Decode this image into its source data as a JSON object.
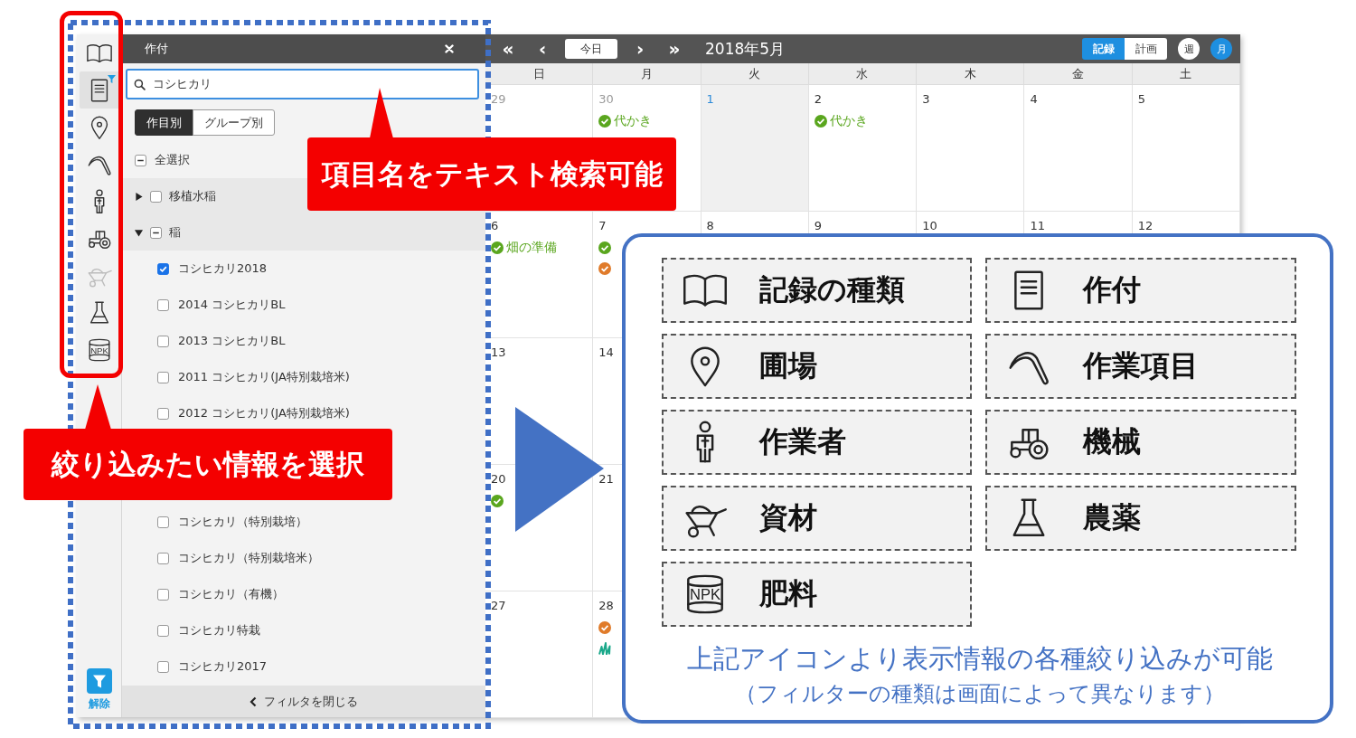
{
  "sidebar": {
    "items": [
      {
        "kind": "records",
        "selected": false,
        "disabled": false,
        "filtered": false
      },
      {
        "kind": "crops",
        "selected": true,
        "disabled": false,
        "filtered": true
      },
      {
        "kind": "fields",
        "selected": false,
        "disabled": false,
        "filtered": false
      },
      {
        "kind": "tasks",
        "selected": false,
        "disabled": false,
        "filtered": false
      },
      {
        "kind": "workers",
        "selected": false,
        "disabled": false,
        "filtered": false
      },
      {
        "kind": "machines",
        "selected": false,
        "disabled": false,
        "filtered": false
      },
      {
        "kind": "materials",
        "selected": false,
        "disabled": true,
        "filtered": false
      },
      {
        "kind": "pesticides",
        "selected": false,
        "disabled": false,
        "filtered": false
      },
      {
        "kind": "fertilizers",
        "selected": false,
        "disabled": false,
        "filtered": false,
        "icon_label": "NPK"
      }
    ],
    "clear_button": {
      "label": "解除"
    }
  },
  "filter_panel": {
    "title": "作付",
    "search": {
      "value": "コシヒカリ"
    },
    "group_tabs": [
      {
        "label": "作目別",
        "selected": true
      },
      {
        "label": "グループ別",
        "selected": false
      }
    ],
    "select_all": {
      "label": "全選択",
      "checked": false,
      "mixed": true
    },
    "groups": [
      {
        "label": "移植水稲",
        "expanded": false,
        "checked": false,
        "mixed": false
      },
      {
        "label": "稲",
        "expanded": true,
        "checked": false,
        "mixed": true,
        "children": [
          {
            "label": "コシヒカリ2018",
            "checked": true
          },
          {
            "label": "2014 コシヒカリBL",
            "checked": false
          },
          {
            "label": "2013 コシヒカリBL",
            "checked": false
          },
          {
            "label": "2011 コシヒカリ(JA特別栽培米)",
            "checked": false
          },
          {
            "label": "2012 コシヒカリ(JA特別栽培米)",
            "checked": false
          },
          {
            "label": "コシヒカリ（特別栽培）",
            "checked": false
          },
          {
            "label": "コシヒカリ（特別栽培米）",
            "checked": false
          },
          {
            "label": "コシヒカリ（有機）",
            "checked": false
          },
          {
            "label": "コシヒカリ特栽",
            "checked": false
          },
          {
            "label": "コシヒカリ2017",
            "checked": false
          }
        ]
      }
    ],
    "footer": {
      "label": "フィルタを閉じる"
    }
  },
  "calendar": {
    "nav": [
      {
        "kind": "arrow",
        "label": "«"
      },
      {
        "kind": "arrow",
        "label": "‹"
      },
      {
        "kind": "today",
        "label": "今日"
      },
      {
        "kind": "arrow",
        "label": "›"
      },
      {
        "kind": "arrow",
        "label": "»"
      }
    ],
    "title": "2018年5月",
    "mode_tabs": [
      {
        "label": "記録",
        "selected": true
      },
      {
        "label": "計画",
        "selected": false
      }
    ],
    "view_buttons": [
      {
        "label": "週",
        "selected": false
      },
      {
        "label": "月",
        "selected": true
      }
    ],
    "weekdays": [
      "日",
      "月",
      "火",
      "水",
      "木",
      "金",
      "土"
    ],
    "weeks": [
      {
        "days": [
          {
            "day": "29",
            "outside": true,
            "today": false
          },
          {
            "day": "30",
            "outside": true,
            "today": false,
            "events": [
              {
                "kind": "done",
                "color": "#5aa61e",
                "label": "代かき"
              }
            ]
          },
          {
            "day": "1",
            "outside": false,
            "today": true
          },
          {
            "day": "2",
            "outside": false,
            "today": false,
            "events": [
              {
                "kind": "done",
                "color": "#5aa61e",
                "label": "代かき"
              }
            ]
          },
          {
            "day": "3",
            "outside": false,
            "today": false
          },
          {
            "day": "4",
            "outside": false,
            "today": false
          },
          {
            "day": "5",
            "outside": false,
            "today": false
          }
        ]
      },
      {
        "days": [
          {
            "day": "6",
            "outside": false,
            "today": false,
            "events": [
              {
                "kind": "done",
                "color": "#5aa61e",
                "label": "畑の準備"
              }
            ]
          },
          {
            "day": "7",
            "outside": false,
            "today": false,
            "events": [
              {
                "kind": "done",
                "color": "#5aa61e"
              },
              {
                "kind": "done",
                "color": "#e07b2a"
              }
            ]
          },
          {
            "day": "8",
            "outside": false,
            "today": false
          },
          {
            "day": "9",
            "outside": false,
            "today": false
          },
          {
            "day": "10",
            "outside": false,
            "today": false
          },
          {
            "day": "11",
            "outside": false,
            "today": false
          },
          {
            "day": "12",
            "outside": false,
            "today": false
          }
        ]
      },
      {
        "days": [
          {
            "day": "13",
            "outside": false,
            "today": false
          },
          {
            "day": "14",
            "outside": false,
            "today": false
          }
        ]
      },
      {
        "days": [
          {
            "day": "20",
            "outside": false,
            "today": false,
            "events": [
              {
                "kind": "done",
                "color": "#5aa61e"
              }
            ]
          },
          {
            "day": "21",
            "outside": false,
            "today": false
          }
        ]
      },
      {
        "days": [
          {
            "day": "27",
            "outside": false,
            "today": false
          },
          {
            "day": "28",
            "outside": false,
            "today": false,
            "events": [
              {
                "kind": "done",
                "color": "#e07b2a"
              },
              {
                "kind": "growth",
                "color": "#1aa88a"
              }
            ]
          }
        ]
      }
    ]
  },
  "annotations": {
    "search_callout": {
      "text": "項目名をテキスト検索可能"
    },
    "select_callout": {
      "text": "絞り込みたい情報を選択"
    },
    "legend": {
      "items": [
        {
          "kind": "records",
          "label": "記録の種類"
        },
        {
          "kind": "crops",
          "label": "作付"
        },
        {
          "kind": "fields",
          "label": "圃場"
        },
        {
          "kind": "tasks",
          "label": "作業項目"
        },
        {
          "kind": "workers",
          "label": "作業者"
        },
        {
          "kind": "machines",
          "label": "機械"
        },
        {
          "kind": "materials",
          "label": "資材"
        },
        {
          "kind": "pesticides",
          "label": "農薬"
        },
        {
          "kind": "fertilizers",
          "label": "肥料",
          "icon_label": "NPK"
        }
      ],
      "caption": "上記アイコンより表示情報の各種絞り込みが可能",
      "note": "（フィルターの種類は画面によって異なります）"
    }
  }
}
